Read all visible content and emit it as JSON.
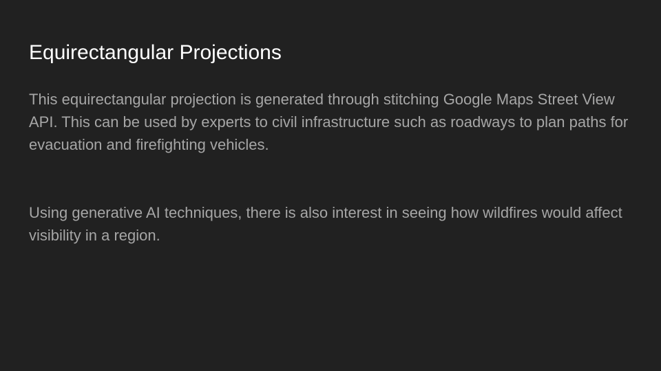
{
  "slide": {
    "title": "Equirectangular Projections",
    "paragraphs": [
      "This equirectangular projection is generated through stitching Google Maps Street View API. This can be used by experts to civil infrastructure such as roadways to plan paths for evacuation and firefighting vehicles.",
      "Using generative AI techniques, there is also interest in seeing how wildfires would affect visibility in a region."
    ]
  },
  "colors": {
    "background": "#212121",
    "title_text": "#ffffff",
    "body_text": "#a6a6a6"
  }
}
